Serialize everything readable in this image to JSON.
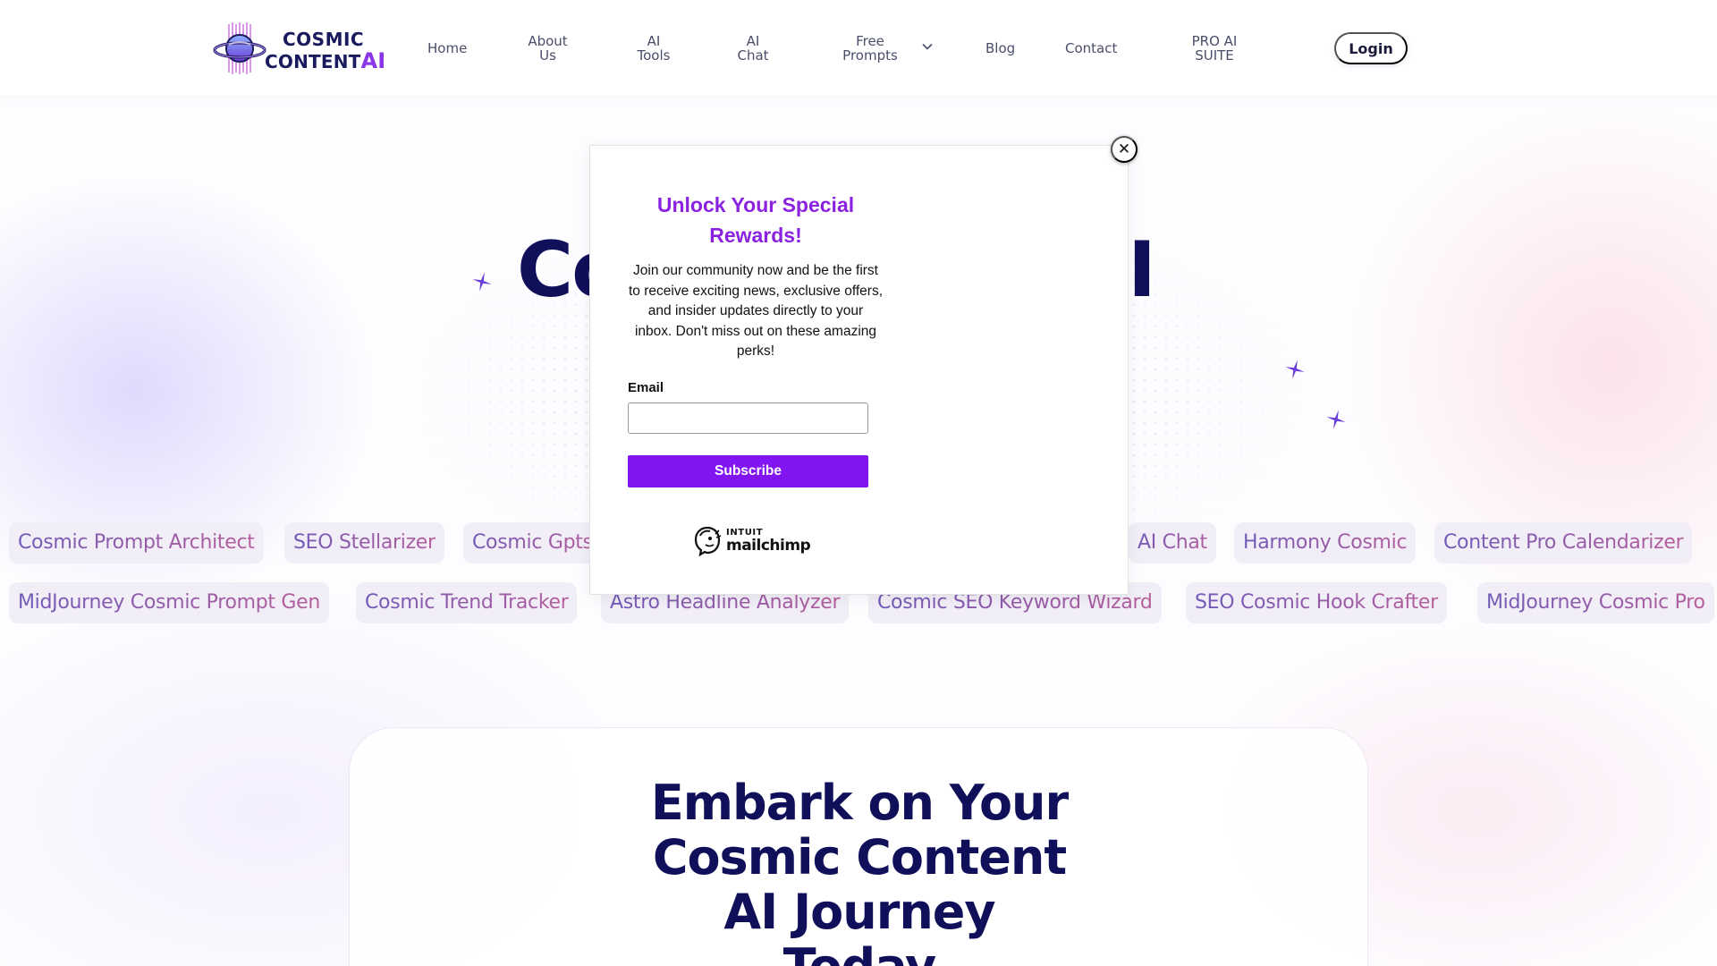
{
  "header": {
    "logo": {
      "line1": "COSMIC",
      "line2": "CONTENT",
      "line2_accent": "AI"
    },
    "nav": [
      {
        "label": "Home"
      },
      {
        "label": "About\nUs"
      },
      {
        "label": "AI\nTools"
      },
      {
        "label": "AI\nChat"
      },
      {
        "label": "Free\nPrompts"
      },
      {
        "label": "Blog"
      },
      {
        "label": "Contact"
      },
      {
        "label": "PRO AI\nSUITE"
      }
    ],
    "login_label": "Login"
  },
  "hero": {
    "title_left": "Co",
    "title_right": "I"
  },
  "tags": {
    "row1": [
      "Cosmic Prompt Architect",
      "SEO Stellarizer",
      "Cosmic Gpts",
      "AI Chat",
      "Harmony Cosmic",
      "Content Pro Calendarizer"
    ],
    "row2": [
      "MidJourney Cosmic Prompt Gen",
      "Cosmic Trend Tracker",
      "Astro Headline Analyzer",
      "Cosmic SEO Keyword Wizard",
      "SEO Cosmic Hook Crafter",
      "MidJourney Cosmic Pro"
    ]
  },
  "card": {
    "title_lines": [
      "Embark on Your",
      "Cosmic Content",
      "AI Journey",
      "Today"
    ]
  },
  "modal": {
    "title": "Unlock Your Special Rewards!",
    "body": "Join our community now and be the first to receive exciting news, exclusive offers, and insider updates directly to your inbox. Don't miss out on these amazing perks!",
    "email_label": "Email",
    "email_value": "",
    "subscribe_label": "Subscribe",
    "close_label": "✕",
    "badge": {
      "intuit": "INTUIT",
      "name": "mailchimp"
    }
  },
  "colors": {
    "brand_purple": "#8214f2",
    "heading_navy": "#10105a",
    "modal_title": "#8a22e0"
  },
  "icons": [
    "saturn-logo-icon",
    "chevron-down-icon",
    "sparkle-icon",
    "close-icon",
    "mailchimp-freddie-icon"
  ]
}
